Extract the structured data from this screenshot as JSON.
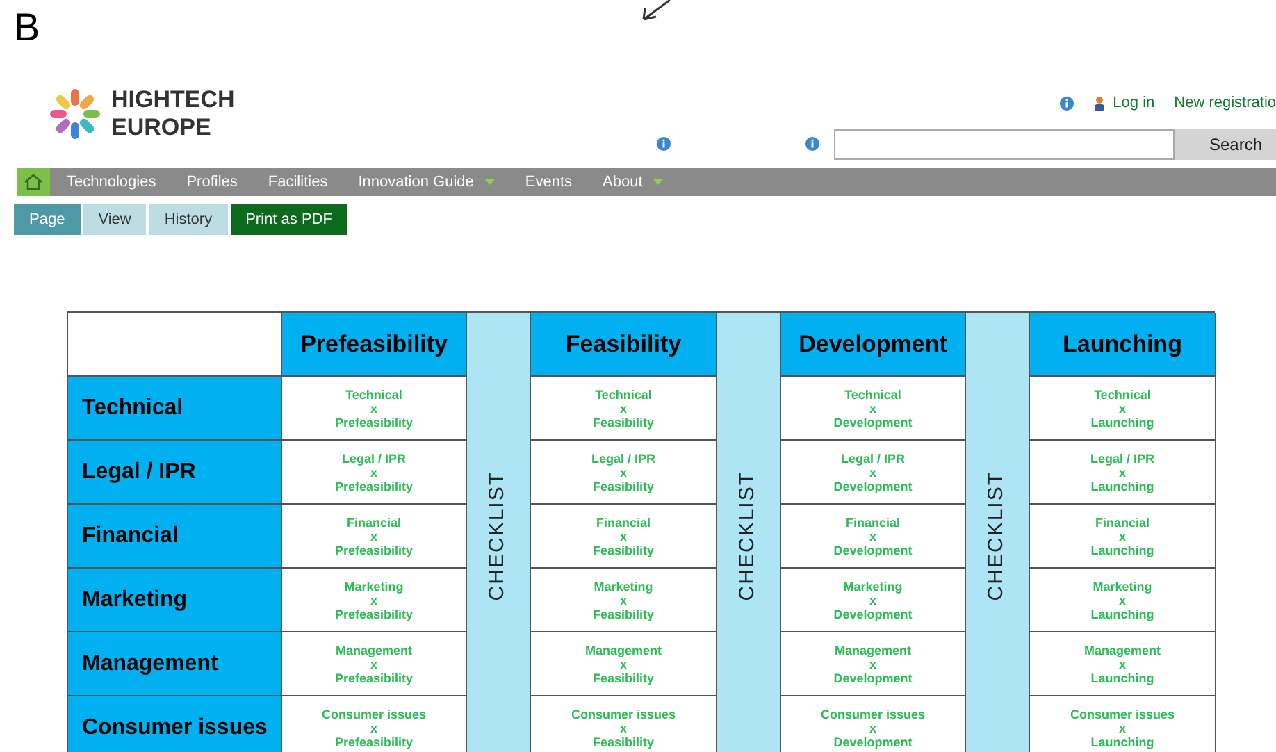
{
  "figure_label": "B",
  "header": {
    "logo_lines": [
      "HIGHTECH",
      "EUROPE"
    ],
    "login": "Log in",
    "registration": "New registratio",
    "search_button": "Search"
  },
  "nav": [
    {
      "label": "Technologies",
      "dropdown": false
    },
    {
      "label": "Profiles",
      "dropdown": false
    },
    {
      "label": "Facilities",
      "dropdown": false
    },
    {
      "label": "Innovation Guide",
      "dropdown": true
    },
    {
      "label": "Events",
      "dropdown": false
    },
    {
      "label": "About",
      "dropdown": true
    }
  ],
  "tabs": [
    {
      "label": "Page",
      "selected": true
    },
    {
      "label": "View",
      "selected": false
    },
    {
      "label": "History",
      "selected": false
    }
  ],
  "print_button": "Print as PDF",
  "table": {
    "checklists": [
      "CHECKLIST",
      "CHECKLIST",
      "CHECKLIST"
    ],
    "phases": [
      "Prefeasibility",
      "Feasibility",
      "Development",
      "Launching"
    ],
    "rows": [
      {
        "label": "Technical",
        "cells": [
          [
            "Technical",
            "x",
            "Prefeasibility"
          ],
          [
            "Technical",
            "x",
            "Feasibility"
          ],
          [
            "Technical",
            "x",
            "Development"
          ],
          [
            "Technical",
            "x",
            "Launching"
          ]
        ]
      },
      {
        "label": "Legal / IPR",
        "cells": [
          [
            "Legal / IPR",
            "x",
            "Prefeasibility"
          ],
          [
            "Legal / IPR",
            "x",
            "Feasibility"
          ],
          [
            "Legal / IPR",
            "x",
            "Development"
          ],
          [
            "Legal / IPR",
            "x",
            "Launching"
          ]
        ]
      },
      {
        "label": "Financial",
        "cells": [
          [
            "Financial",
            "x",
            "Prefeasibility"
          ],
          [
            "Financial",
            "x",
            "Feasibility"
          ],
          [
            "Financial",
            "x",
            "Development"
          ],
          [
            "Financial",
            "x",
            "Launching"
          ]
        ]
      },
      {
        "label": "Marketing",
        "cells": [
          [
            "Marketing",
            "x",
            "Prefeasibility"
          ],
          [
            "Marketing",
            "x",
            "Feasibility"
          ],
          [
            "Marketing",
            "x",
            "Development"
          ],
          [
            "Marketing",
            "x",
            "Launching"
          ]
        ]
      },
      {
        "label": "Management",
        "cells": [
          [
            "Management",
            "x",
            "Prefeasibility"
          ],
          [
            "Management",
            "x",
            "Feasibility"
          ],
          [
            "Management",
            "x",
            "Development"
          ],
          [
            "Management",
            "x",
            "Launching"
          ]
        ]
      },
      {
        "label": "Consumer issues",
        "cells": [
          [
            "Consumer issues",
            "x",
            "Prefeasibility"
          ],
          [
            "Consumer issues",
            "x",
            "Feasibility"
          ],
          [
            "Consumer issues",
            "x",
            "Development"
          ],
          [
            "Consumer issues",
            "x",
            "Launching"
          ]
        ]
      }
    ]
  }
}
